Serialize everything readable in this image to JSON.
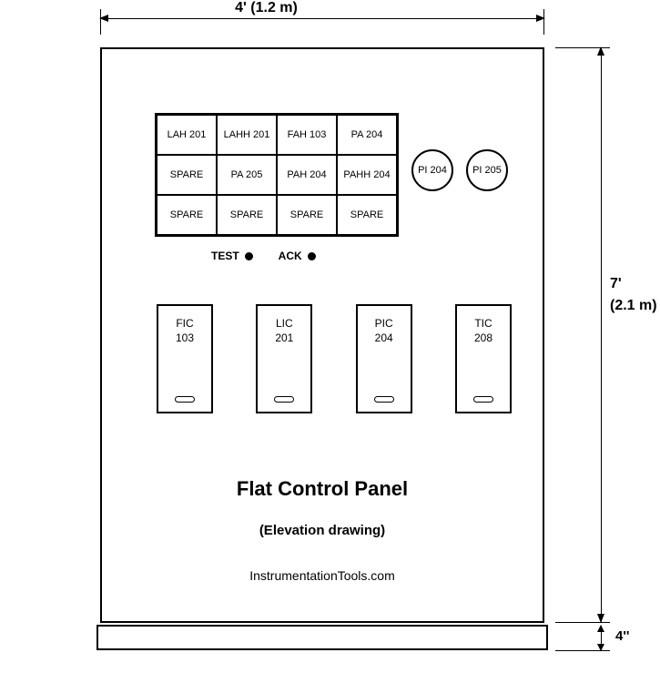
{
  "dimensions": {
    "width_label": "4'   (1.2 m)",
    "height_label_line1": "7'",
    "height_label_line2": "(2.1 m)",
    "base_label": "4''"
  },
  "annunciator": {
    "rows": [
      [
        "LAH 201",
        "LAHH 201",
        "FAH 103",
        "PA 204"
      ],
      [
        "SPARE",
        "PA 205",
        "PAH 204",
        "PAHH 204"
      ],
      [
        "SPARE",
        "SPARE",
        "SPARE",
        "SPARE"
      ]
    ]
  },
  "gauges": [
    {
      "label": "PI 204"
    },
    {
      "label": "PI 205"
    }
  ],
  "buttons": {
    "test": "TEST",
    "ack": "ACK"
  },
  "controllers": [
    {
      "label_line1": "FIC",
      "label_line2": "103"
    },
    {
      "label_line1": "LIC",
      "label_line2": "201"
    },
    {
      "label_line1": "PIC",
      "label_line2": "204"
    },
    {
      "label_line1": "TIC",
      "label_line2": "208"
    }
  ],
  "titles": {
    "main": "Flat Control Panel",
    "sub": "(Elevation drawing)",
    "credit": "InstrumentationTools.com"
  }
}
